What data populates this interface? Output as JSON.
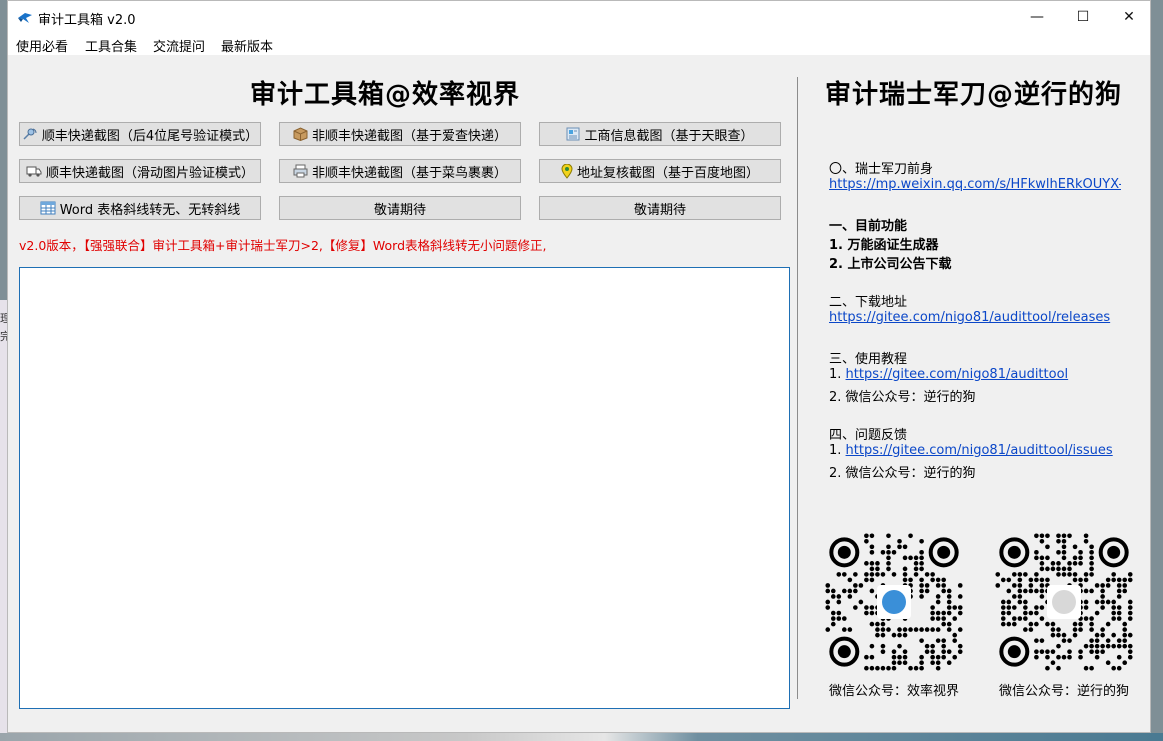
{
  "window": {
    "title": "审计工具箱 v2.0",
    "controls": {
      "minimize": "—",
      "maximize": "☐",
      "close": "✕"
    }
  },
  "menu": [
    "使用必看",
    "工具合集",
    "交流提问",
    "最新版本"
  ],
  "left_panel": {
    "title": "审计工具箱@效率视界",
    "buttons": [
      {
        "label": "顺丰快递截图（后4位尾号验证模式）",
        "icon": "satellite-icon"
      },
      {
        "label": "非顺丰快递截图（基于爱查快递）",
        "icon": "package-icon"
      },
      {
        "label": "工商信息截图（基于天眼查）",
        "icon": "document-icon"
      },
      {
        "label": "顺丰快递截图（滑动图片验证模式）",
        "icon": "truck-icon"
      },
      {
        "label": "非顺丰快递截图（基于菜鸟裹裹）",
        "icon": "printer-icon"
      },
      {
        "label": "地址复核截图（基于百度地图）",
        "icon": "map-pin-icon"
      },
      {
        "label": "Word 表格斜线转无、无转斜线",
        "icon": "table-icon"
      },
      {
        "label": "敬请期待",
        "icon": ""
      },
      {
        "label": "敬请期待",
        "icon": ""
      }
    ],
    "version_note": "v2.0版本，【强强联合】审计工具箱+审计瑞士军刀>2,【修复】Word表格斜线转无小问题修正,",
    "output_text": ""
  },
  "right_panel": {
    "title": "审计瑞士军刀@逆行的狗",
    "sections": {
      "s0_heading": "〇、瑞士军刀前身",
      "s0_link": "https://mp.weixin.qq.com/s/HFkwlhERkOUYX-N",
      "s1_heading": "一、目前功能",
      "s1_item1": "1. 万能函证生成器",
      "s1_item2": "2. 上市公司公告下载",
      "s2_heading": "二、下载地址",
      "s2_link": "https://gitee.com/nigo81/audittool/releases",
      "s3_heading": "三、使用教程",
      "s3_prefix1": "1. ",
      "s3_link": "https://gitee.com/nigo81/audittool",
      "s3_item2": "2. 微信公众号：逆行的狗",
      "s4_heading": "四、问题反馈",
      "s4_prefix1": "1. ",
      "s4_link": "https://gitee.com/nigo81/audittool/issues",
      "s4_item2": "2. 微信公众号：逆行的狗"
    },
    "qr_captions": [
      "微信公众号：效率视界",
      "微信公众号：逆行的狗"
    ]
  },
  "colors": {
    "link": "#0b47c8",
    "note": "#e00000",
    "accent_border": "#1e6fb4"
  }
}
